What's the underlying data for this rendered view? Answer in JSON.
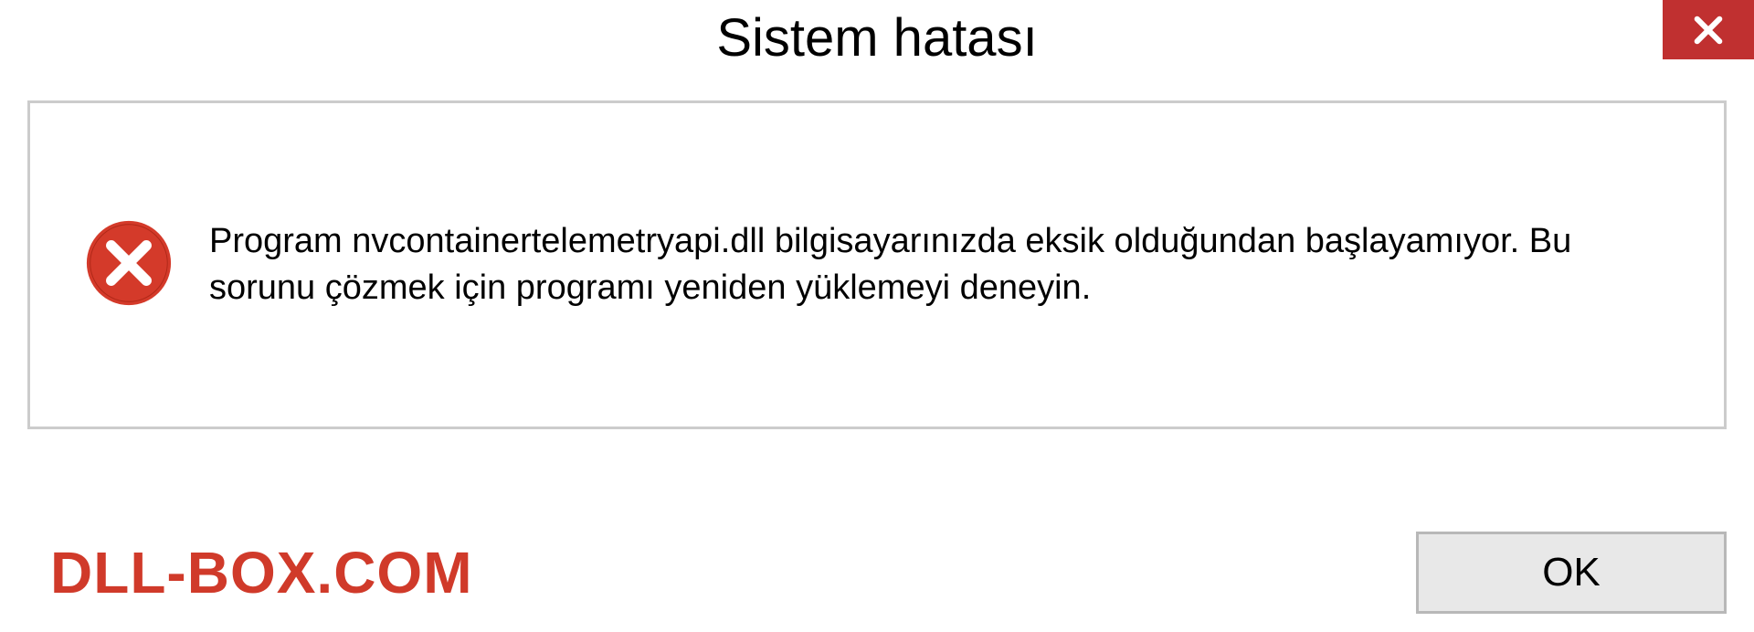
{
  "dialog": {
    "title": "Sistem hatası",
    "message": "Program nvcontainertelemetryapi.dll bilgisayarınızda eksik olduğundan başlayamıyor. Bu sorunu çözmek için programı yeniden yüklemeyi deneyin.",
    "ok_label": "OK"
  },
  "watermark": "DLL-BOX.COM",
  "colors": {
    "close_bg": "#c03030",
    "error_icon": "#d43a2a",
    "watermark": "#d03a2a"
  }
}
